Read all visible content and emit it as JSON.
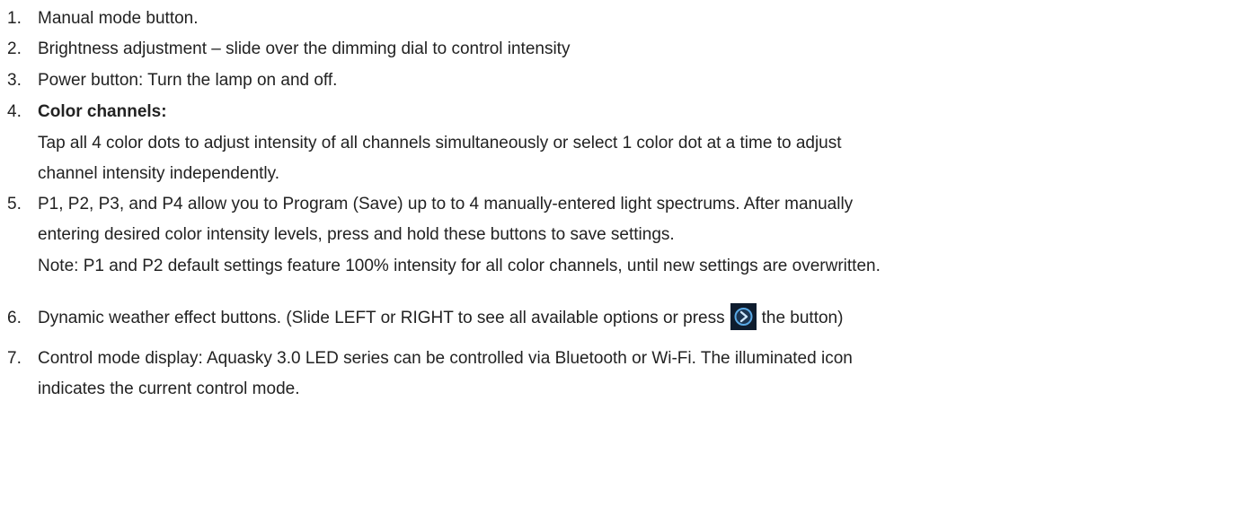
{
  "items": [
    {
      "num": "1.",
      "text": "Manual mode button."
    },
    {
      "num": "2.",
      "text": "Brightness adjustment – slide over the dimming dial to control intensity"
    },
    {
      "num": "3.",
      "text": "Power button: Turn the lamp on and off."
    },
    {
      "num": "4.",
      "title": "Color channels:",
      "body": [
        "Tap all 4 color dots to adjust intensity of all channels simultaneously or select 1 color dot at a time to adjust",
        "channel intensity independently."
      ]
    },
    {
      "num": "5.",
      "lines": [
        "P1, P2, P3, and P4 allow you to Program (Save) up to to 4 manually-entered light spectrums. After manually",
        "entering desired color intensity levels, press and hold these buttons to save settings.",
        "Note: P1 and P2 default settings feature 100% intensity for all color channels, until new settings are overwritten."
      ]
    },
    {
      "num": "6.",
      "text_before": "Dynamic weather effect buttons. (Slide LEFT or RIGHT to see all available options or press",
      "icon": "next-arrow-icon",
      "text_after": "the button)"
    },
    {
      "num": "7.",
      "lines": [
        "Control mode display: Aquasky 3.0 LED series can be controlled via Bluetooth or Wi-Fi. The illuminated icon",
        "indicates the current control mode."
      ]
    }
  ],
  "colors": {
    "text": "#222222",
    "icon_bg": "#0e1c2e",
    "icon_ring": "#5aa9e6"
  }
}
